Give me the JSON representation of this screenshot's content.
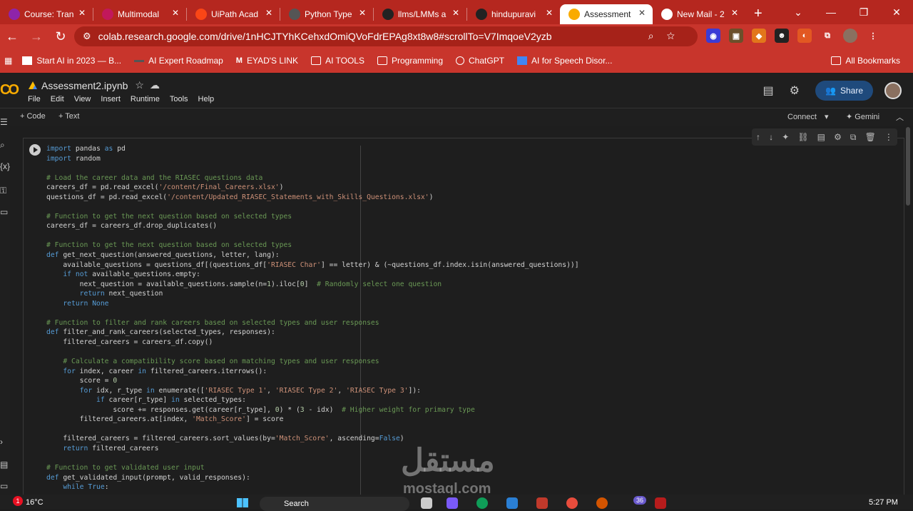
{
  "browser": {
    "tabs": [
      {
        "title": "Course: Tran",
        "icon_color": "#8e24aa",
        "icon": "course-icon"
      },
      {
        "title": "Multimodal",
        "icon_color": "#c2185b",
        "icon": "multimodal-icon"
      },
      {
        "title": "UiPath Acad",
        "icon_color": "#fa4616",
        "icon": "uipath-icon"
      },
      {
        "title": "Python Type",
        "icon_color": "#555",
        "icon": "python-icon"
      },
      {
        "title": "llms/LMMs a",
        "icon_color": "#222",
        "icon": "github-icon"
      },
      {
        "title": "hindupuravi",
        "icon_color": "#222",
        "icon": "github-icon"
      },
      {
        "title": "Assessment",
        "icon_color": "#f9ab00",
        "icon": "colab-icon"
      },
      {
        "title": "New Mail - 2",
        "icon_color": "#fff",
        "icon": "mail-icon"
      }
    ],
    "url": "colab.research.google.com/drive/1nHCJTYhKCehxdOmiQVoFdrEPAg8xt8w8#scrollTo=V7ImqoeV2yzb",
    "bookmarks": [
      {
        "label": "Start AI in 2023 — B..."
      },
      {
        "label": "AI Expert Roadmap"
      },
      {
        "label": "EYAD'S LINK"
      },
      {
        "label": "AI TOOLS"
      },
      {
        "label": "Programming"
      },
      {
        "label": "ChatGPT"
      },
      {
        "label": "AI for Speech Disor..."
      }
    ],
    "all_bookmarks": "All Bookmarks"
  },
  "colab": {
    "notebook_title": "Assessment2.ipynb",
    "menu": [
      "File",
      "Edit",
      "View",
      "Insert",
      "Runtime",
      "Tools",
      "Help"
    ],
    "share_label": "Share",
    "add_code": "+ Code",
    "add_text": "+ Text",
    "connect": "Connect",
    "gemini": "✦ Gemini"
  },
  "code_lines": [
    "import pandas as pd",
    "import random",
    "",
    "# Load the career data and the RIASEC questions data",
    "careers_df = pd.read_excel('/content/Final_Careers.xlsx')",
    "questions_df = pd.read_excel('/content/Updated_RIASEC_Statements_with_Skills_Questions.xlsx')",
    "",
    "# Function to get the next question based on selected types",
    "careers_df = careers_df.drop_duplicates()",
    "",
    "# Function to get the next question based on selected types",
    "def get_next_question(answered_questions, letter, lang):",
    "    available_questions = questions_df[(questions_df['RIASEC Char'] == letter) & (~questions_df.index.isin(answered_questions))]",
    "    if not available_questions.empty:",
    "        next_question = available_questions.sample(n=1).iloc[0]  # Randomly select one question",
    "        return next_question",
    "    return None",
    "",
    "# Function to filter and rank careers based on selected types and user responses",
    "def filter_and_rank_careers(selected_types, responses):",
    "    filtered_careers = careers_df.copy()",
    "",
    "    # Calculate a compatibility score based on matching types and user responses",
    "    for index, career in filtered_careers.iterrows():",
    "        score = 0",
    "        for idx, r_type in enumerate(['RIASEC Type 1', 'RIASEC Type 2', 'RIASEC Type 3']):",
    "            if career[r_type] in selected_types:",
    "                score += responses.get(career[r_type], 0) * (3 - idx)  # Higher weight for primary type",
    "        filtered_careers.at[index, 'Match_Score'] = score",
    "",
    "    filtered_careers = filtered_careers.sort_values(by='Match_Score', ascending=False)",
    "    return filtered_careers",
    "",
    "# Function to get validated user input",
    "def get_validated_input(prompt, valid_responses):",
    "    while True:"
  ],
  "watermark": {
    "arabic": "مستقل",
    "latin": "mostaql.com"
  },
  "taskbar": {
    "weather": "16°C",
    "notif_count": "1",
    "search": "Search",
    "badge": "36",
    "time": "5:27 PM"
  }
}
